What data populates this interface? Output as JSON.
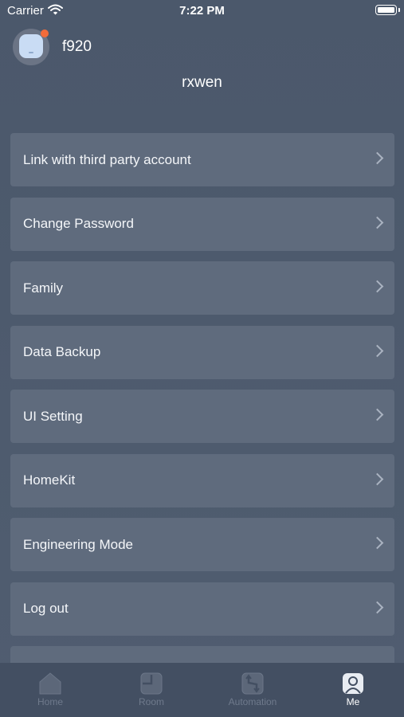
{
  "status_bar": {
    "carrier": "Carrier",
    "time": "7:22 PM"
  },
  "profile": {
    "device_name": "f920",
    "username": "rxwen"
  },
  "menu": [
    {
      "label": "Link with third party account"
    },
    {
      "label": "Change Password"
    },
    {
      "label": "Family"
    },
    {
      "label": "Data Backup"
    },
    {
      "label": "UI Setting"
    },
    {
      "label": "HomeKit"
    },
    {
      "label": "Engineering Mode"
    },
    {
      "label": "Log out"
    }
  ],
  "tabs": [
    {
      "label": "Home",
      "icon": "home-icon"
    },
    {
      "label": "Room",
      "icon": "room-icon"
    },
    {
      "label": "Automation",
      "icon": "automation-icon"
    },
    {
      "label": "Me",
      "icon": "me-icon",
      "active": true
    }
  ],
  "colors": {
    "background": "#4b586b",
    "card": "#5f6b7d",
    "tabbar": "#434f62",
    "notification_dot": "#f26b3a",
    "inactive_tab": "#6f7a8c"
  }
}
